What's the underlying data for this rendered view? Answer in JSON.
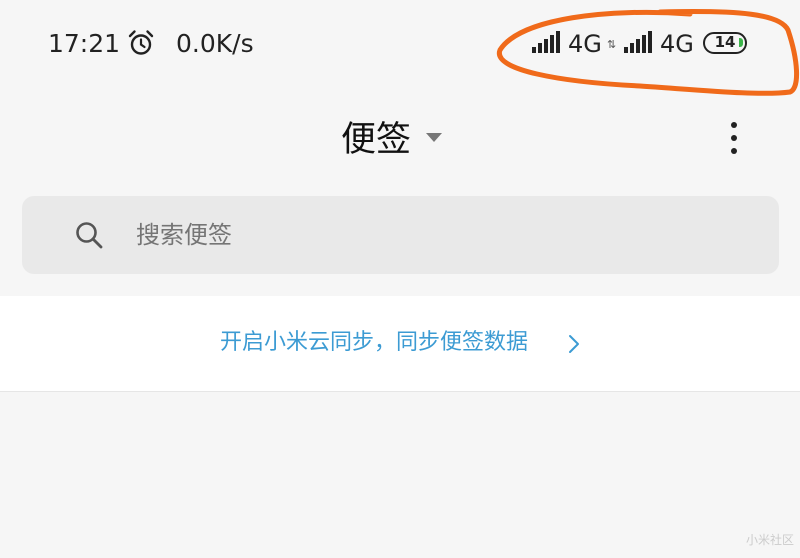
{
  "status_bar": {
    "time": "17:21",
    "alarm_icon": "alarm-clock-icon",
    "net_speed": "0.0K/s",
    "sim1_network": "4G",
    "data_arrows": "⇅",
    "sim2_network": "4G",
    "battery_level": "14",
    "battery_color": "#3cb54a"
  },
  "header": {
    "title": "便签",
    "dropdown_icon": "caret-down-icon",
    "more_icon": "more-vertical-icon"
  },
  "search": {
    "icon": "search-icon",
    "placeholder": "搜索便签"
  },
  "sync_banner": {
    "text": "开启小米云同步，同步便签数据",
    "accent_color": "#3c9bd3"
  },
  "annotation_color": "#f06a1a",
  "watermark": "小米社区"
}
